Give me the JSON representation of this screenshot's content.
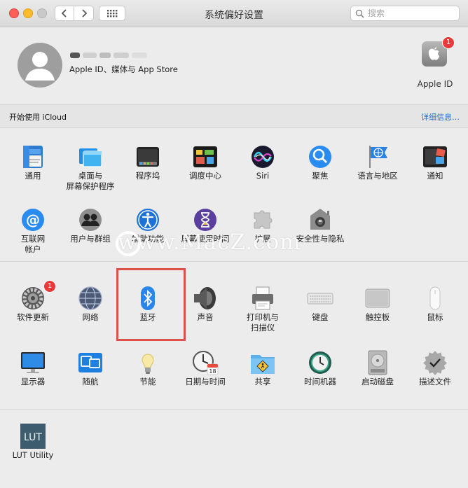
{
  "window": {
    "title": "系统偏好设置"
  },
  "search": {
    "placeholder": "搜索",
    "value": ""
  },
  "account": {
    "subtitle": "Apple ID、媒体与 App Store",
    "apple_id_label": "Apple ID",
    "apple_id_badge": "1"
  },
  "icloud": {
    "text": "开始使用 iCloud",
    "link": "详细信息…"
  },
  "section1": [
    {
      "label": "通用",
      "icon": "general-icon"
    },
    {
      "label": "桌面与\n屏幕保护程序",
      "icon": "desktop-screensaver-icon"
    },
    {
      "label": "程序坞",
      "icon": "dock-icon"
    },
    {
      "label": "调度中心",
      "icon": "mission-control-icon"
    },
    {
      "label": "Siri",
      "icon": "siri-icon"
    },
    {
      "label": "聚焦",
      "icon": "spotlight-icon"
    },
    {
      "label": "语言与地区",
      "icon": "language-region-icon"
    },
    {
      "label": "通知",
      "icon": "notifications-icon"
    },
    {
      "label": "互联网\n帐户",
      "icon": "internet-accounts-icon"
    },
    {
      "label": "用户与群组",
      "icon": "users-groups-icon"
    },
    {
      "label": "辅助功能",
      "icon": "accessibility-icon"
    },
    {
      "label": "屏幕使用时间",
      "icon": "screen-time-icon"
    },
    {
      "label": "扩展",
      "icon": "extensions-icon"
    },
    {
      "label": "安全性与隐私",
      "icon": "security-privacy-icon"
    }
  ],
  "section2": [
    {
      "label": "软件更新",
      "icon": "software-update-icon",
      "badge": "1"
    },
    {
      "label": "网络",
      "icon": "network-icon"
    },
    {
      "label": "蓝牙",
      "icon": "bluetooth-icon"
    },
    {
      "label": "声音",
      "icon": "sound-icon"
    },
    {
      "label": "打印机与\n扫描仪",
      "icon": "printers-scanners-icon"
    },
    {
      "label": "键盘",
      "icon": "keyboard-icon"
    },
    {
      "label": "触控板",
      "icon": "trackpad-icon"
    },
    {
      "label": "鼠标",
      "icon": "mouse-icon"
    },
    {
      "label": "显示器",
      "icon": "displays-icon"
    },
    {
      "label": "随航",
      "icon": "sidecar-icon"
    },
    {
      "label": "节能",
      "icon": "energy-saver-icon"
    },
    {
      "label": "日期与时间",
      "icon": "date-time-icon",
      "icon_text": "18"
    },
    {
      "label": "共享",
      "icon": "sharing-icon"
    },
    {
      "label": "时间机器",
      "icon": "time-machine-icon"
    },
    {
      "label": "启动磁盘",
      "icon": "startup-disk-icon"
    },
    {
      "label": "描述文件",
      "icon": "profiles-icon"
    }
  ],
  "section3": [
    {
      "label": "LUT Utility",
      "icon": "lut-utility-icon",
      "icon_text": "LUT"
    }
  ],
  "watermark": {
    "text": "www.MacZ.com"
  }
}
